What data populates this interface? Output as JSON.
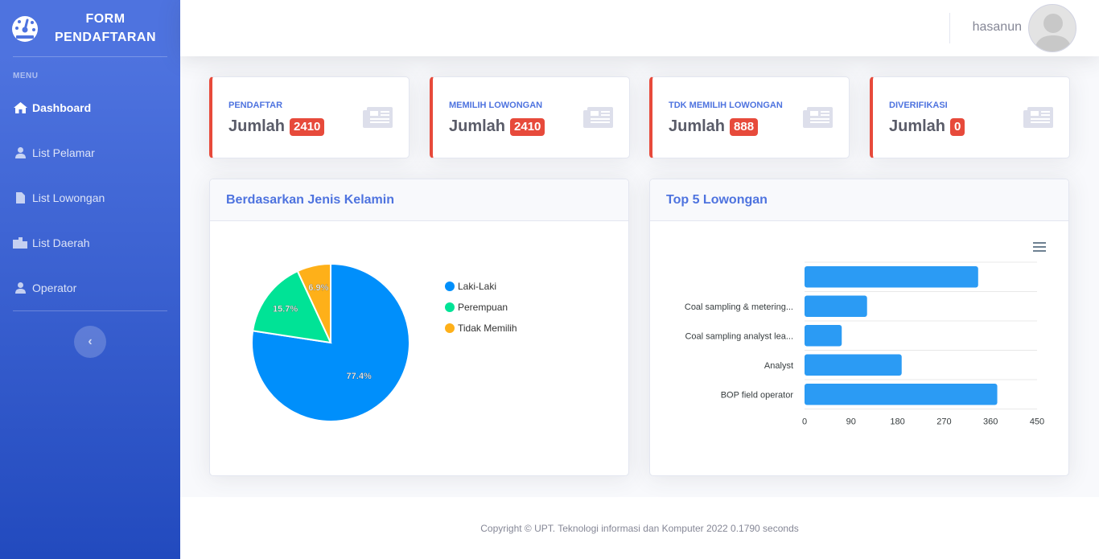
{
  "brand": {
    "title_line1": "FORM",
    "title_line2": "PENDAFTARAN"
  },
  "sidebar": {
    "heading": "MENU",
    "items": [
      {
        "label": "Dashboard",
        "icon": "home-icon",
        "active": true
      },
      {
        "label": "List Pelamar",
        "icon": "user-icon",
        "active": false
      },
      {
        "label": "List Lowongan",
        "icon": "file-icon",
        "active": false
      },
      {
        "label": "List Daerah",
        "icon": "building-icon",
        "active": false
      },
      {
        "label": "Operator",
        "icon": "user-icon",
        "active": false
      }
    ],
    "toggle_icon": "chevron-left-icon"
  },
  "topbar": {
    "username": "hasanun"
  },
  "stats": [
    {
      "label": "PENDAFTAR",
      "text": "Jumlah",
      "value": "2410"
    },
    {
      "label": "MEMILIH LOWONGAN",
      "text": "Jumlah",
      "value": "2410"
    },
    {
      "label": "TDK MEMILIH LOWONGAN",
      "text": "Jumlah",
      "value": "888"
    },
    {
      "label": "DIVERIFIKASI",
      "text": "Jumlah",
      "value": "0"
    }
  ],
  "panels": {
    "gender": {
      "title": "Berdasarkan Jenis Kelamin"
    },
    "top5": {
      "title": "Top 5 Lowongan"
    }
  },
  "colors": {
    "primary": "#4e73df",
    "danger": "#e74a3b",
    "bar": "#2b9bf4"
  },
  "chart_data": [
    {
      "type": "pie",
      "labels": [
        "Laki-Laki",
        "Perempuan",
        "Tidak Memilih"
      ],
      "values": [
        77.4,
        15.7,
        6.9
      ],
      "value_labels": [
        "77.4%",
        "15.7%",
        "6.9%"
      ],
      "colors": [
        "#008ffb",
        "#00e396",
        "#feb019"
      ],
      "legend": "right"
    },
    {
      "type": "bar",
      "orientation": "horizontal",
      "categories": [
        "",
        "Coal sampling & metering...",
        "Coal sampling analyst lea...",
        "Analyst",
        "BOP field operator"
      ],
      "values": [
        336,
        121,
        72,
        188,
        373
      ],
      "xlim": [
        0,
        450
      ],
      "xticks": [
        "0",
        "90",
        "180",
        "270",
        "360",
        "450"
      ],
      "menu_icon": "hamburger-menu-icon"
    }
  ],
  "footer": {
    "text": "Copyright © UPT. Teknologi informasi dan Komputer 2022 0.1790 seconds"
  }
}
